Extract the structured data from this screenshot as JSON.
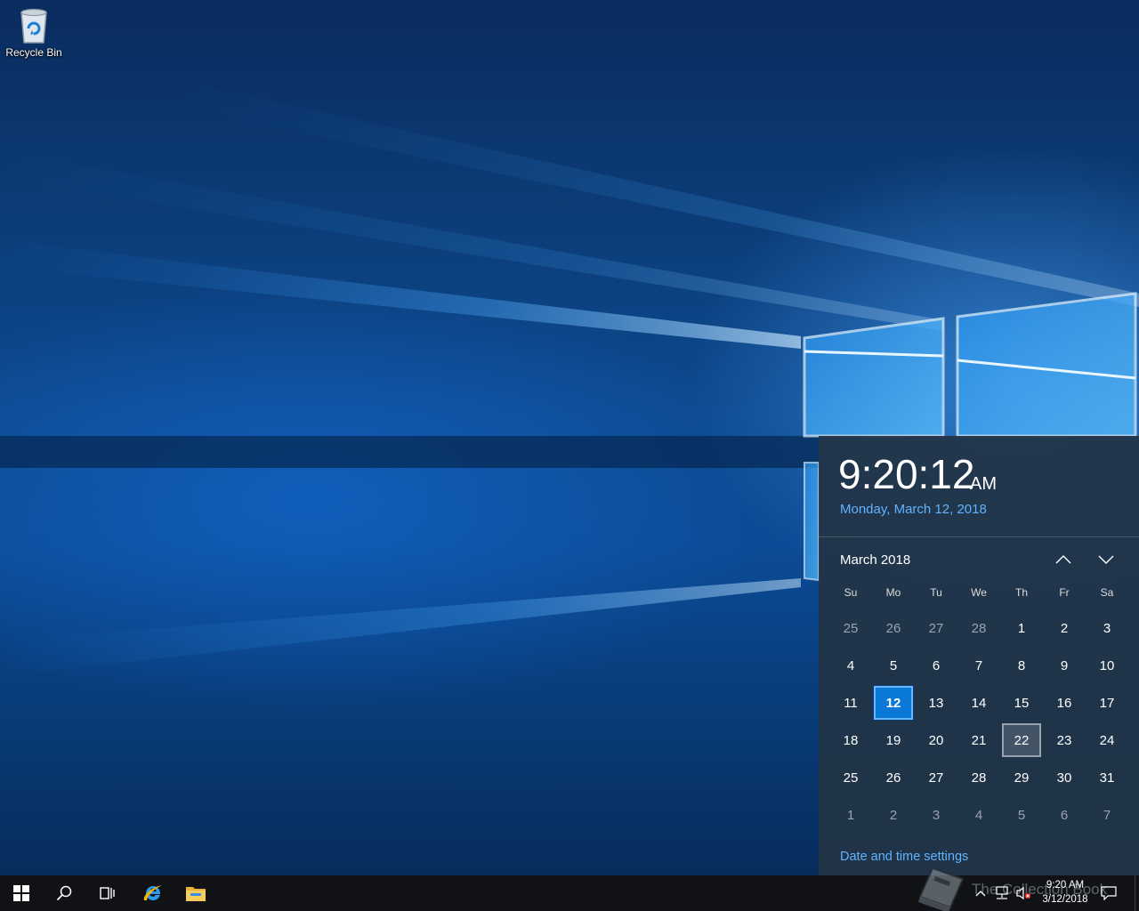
{
  "desktop": {
    "icons": [
      {
        "label": "Recycle Bin",
        "icon": "recycle-bin-icon"
      }
    ]
  },
  "flyout": {
    "time": "9:20:12",
    "ampm": "AM",
    "long_date": "Monday, March 12, 2018",
    "month_label": "March 2018",
    "weekdays": [
      "Su",
      "Mo",
      "Tu",
      "We",
      "Th",
      "Fr",
      "Sa"
    ],
    "days": [
      {
        "n": "25",
        "cur": false
      },
      {
        "n": "26",
        "cur": false
      },
      {
        "n": "27",
        "cur": false
      },
      {
        "n": "28",
        "cur": false
      },
      {
        "n": "1",
        "cur": true
      },
      {
        "n": "2",
        "cur": true
      },
      {
        "n": "3",
        "cur": true
      },
      {
        "n": "4",
        "cur": true
      },
      {
        "n": "5",
        "cur": true
      },
      {
        "n": "6",
        "cur": true
      },
      {
        "n": "7",
        "cur": true
      },
      {
        "n": "8",
        "cur": true
      },
      {
        "n": "9",
        "cur": true
      },
      {
        "n": "10",
        "cur": true
      },
      {
        "n": "11",
        "cur": true
      },
      {
        "n": "12",
        "cur": true,
        "today": true
      },
      {
        "n": "13",
        "cur": true
      },
      {
        "n": "14",
        "cur": true
      },
      {
        "n": "15",
        "cur": true
      },
      {
        "n": "16",
        "cur": true
      },
      {
        "n": "17",
        "cur": true
      },
      {
        "n": "18",
        "cur": true
      },
      {
        "n": "19",
        "cur": true
      },
      {
        "n": "20",
        "cur": true
      },
      {
        "n": "21",
        "cur": true
      },
      {
        "n": "22",
        "cur": true,
        "hover": true
      },
      {
        "n": "23",
        "cur": true
      },
      {
        "n": "24",
        "cur": true
      },
      {
        "n": "25",
        "cur": true
      },
      {
        "n": "26",
        "cur": true
      },
      {
        "n": "27",
        "cur": true
      },
      {
        "n": "28",
        "cur": true
      },
      {
        "n": "29",
        "cur": true
      },
      {
        "n": "30",
        "cur": true
      },
      {
        "n": "31",
        "cur": true
      },
      {
        "n": "1",
        "cur": false
      },
      {
        "n": "2",
        "cur": false
      },
      {
        "n": "3",
        "cur": false
      },
      {
        "n": "4",
        "cur": false
      },
      {
        "n": "5",
        "cur": false
      },
      {
        "n": "6",
        "cur": false
      },
      {
        "n": "7",
        "cur": false
      }
    ],
    "settings_link": "Date and time settings",
    "accent": "#0a78d7",
    "link_color": "#5fb3ff"
  },
  "taskbar": {
    "buttons": [
      "start-icon",
      "search-icon",
      "task-view-icon",
      "internet-explorer-icon",
      "file-explorer-icon"
    ],
    "tray": {
      "time": "9:20 AM",
      "date": "3/12/2018",
      "icons": [
        "chevron-up-icon",
        "network-icon",
        "volume-muted-icon",
        "notifications-icon"
      ]
    },
    "watermark": "The Collection Book"
  }
}
